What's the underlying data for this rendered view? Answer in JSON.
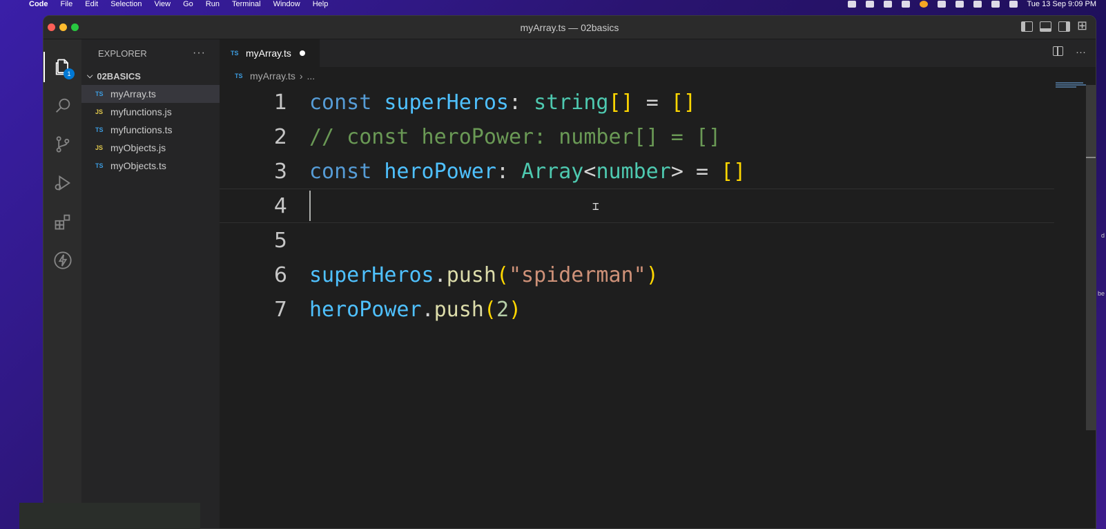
{
  "menubar": {
    "app": "Code",
    "items": [
      "File",
      "Edit",
      "Selection",
      "View",
      "Go",
      "Run",
      "Terminal",
      "Window",
      "Help"
    ],
    "clock": "Tue 13 Sep  9:09 PM"
  },
  "window": {
    "title": "myArray.ts — 02basics"
  },
  "activity": {
    "explorer_badge": "1"
  },
  "sidebar": {
    "header": "EXPLORER",
    "more": "···",
    "folder": "02BASICS",
    "files": [
      {
        "badge": "TS",
        "name": "myArray.ts"
      },
      {
        "badge": "JS",
        "name": "myfunctions.js"
      },
      {
        "badge": "TS",
        "name": "myfunctions.ts"
      },
      {
        "badge": "JS",
        "name": "myObjects.js"
      },
      {
        "badge": "TS",
        "name": "myObjects.ts"
      }
    ]
  },
  "editor": {
    "tab": {
      "badge": "TS",
      "name": "myArray.ts"
    },
    "breadcrumb": {
      "badge": "TS",
      "file": "myArray.ts",
      "rest": "..."
    },
    "more": "···",
    "line_numbers": [
      "1",
      "2",
      "3",
      "4",
      "5",
      "6",
      "7"
    ],
    "lines": {
      "l1": {
        "t1": "const",
        "t2": "superHeros",
        "t3": ":",
        "t4": "string",
        "t5": "[]",
        "t6": "=",
        "t7": "[]"
      },
      "l2": {
        "text": "// const heroPower: number[] = []"
      },
      "l3": {
        "t1": "const",
        "t2": "heroPower",
        "t3": ":",
        "t4": "Array",
        "t5": "<",
        "t6": "number",
        "t7": ">",
        "t8": "=",
        "t9": "[]"
      },
      "l6": {
        "t1": "superHeros",
        "t2": ".",
        "t3": "push",
        "t4": "(",
        "t5": "\"spiderman\"",
        "t6": ")"
      },
      "l7": {
        "t1": "heroPower",
        "t2": ".",
        "t3": "push",
        "t4": "(",
        "t5": "2",
        "t6": ")"
      }
    }
  },
  "edge_labels": [
    "d",
    "be"
  ],
  "colors": {
    "keyword": "#569cd6",
    "variable": "#4fc1ff",
    "type": "#4ec9b0",
    "comment": "#6a9955",
    "function": "#dcdcaa",
    "string": "#ce9178",
    "accent": "#0078d4"
  }
}
